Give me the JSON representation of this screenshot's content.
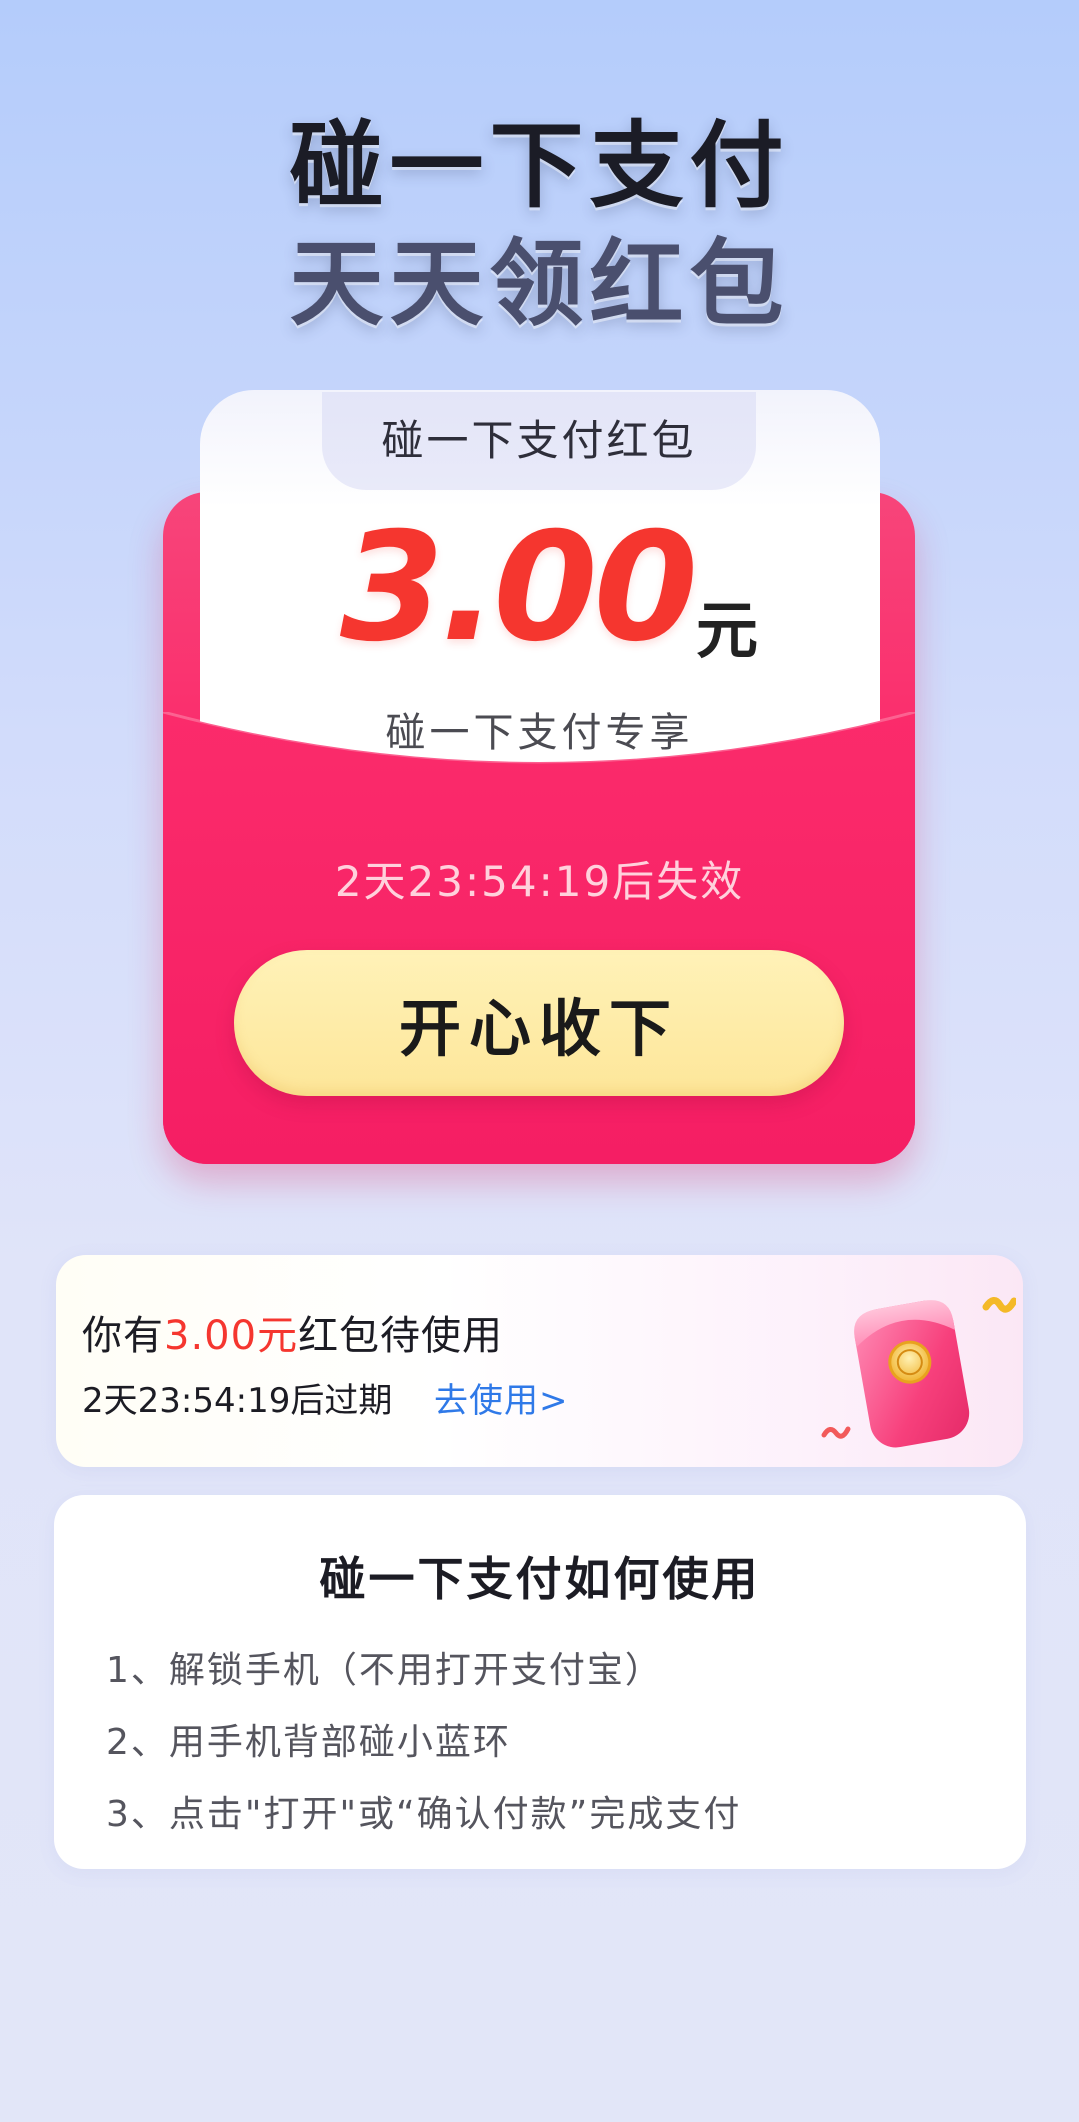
{
  "headline": {
    "line1": "碰一下支付",
    "line2": "天天领红包"
  },
  "red_packet": {
    "tab_label": "碰一下支付红包",
    "amount": "3.00",
    "unit": "元",
    "subtitle": "碰一下支付专享",
    "countdown": "2天23:54:19后失效",
    "accept_button": "开心收下"
  },
  "balance": {
    "prefix": "你有",
    "amount_text": "3.00元",
    "suffix": "红包待使用",
    "expire_text": "2天23:54:19后过期",
    "use_link": "去使用>",
    "illustration_icon": "red-envelope-illustration"
  },
  "howto": {
    "title": "碰一下支付如何使用",
    "steps": [
      "1、解锁手机（不用打开支付宝）",
      "2、用手机背部碰小蓝环",
      "3、点击\"打开\"或“确认付款”完成支付"
    ]
  },
  "colors": {
    "accent_red": "#f5362f",
    "packet_pink": "#fb2b6b",
    "button_yellow": "#fde699",
    "link_blue": "#2f79e8"
  }
}
